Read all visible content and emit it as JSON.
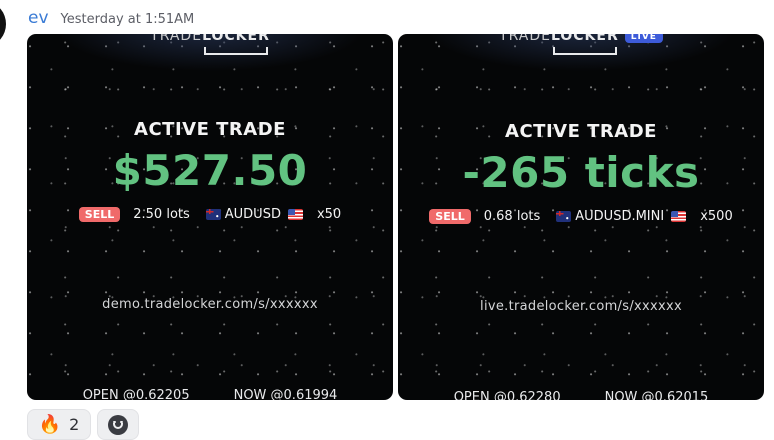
{
  "message": {
    "username": "ev",
    "timestamp": "Yesterday at 1:51AM"
  },
  "cards": [
    {
      "logo_thin": "TRADE",
      "logo_bold": "LOCKER",
      "title": "ACTIVE TRADE",
      "value": "$527.50",
      "side": "SELL",
      "lots": "2.50 lots",
      "symbol": "AUDUSD",
      "multiplier": "x50",
      "url": "demo.tradelocker.com/s/xxxxxx",
      "open": "OPEN @0.62205",
      "now": "NOW @0.61994"
    },
    {
      "logo_thin": "TRADE",
      "logo_bold": "LOCKER",
      "badge": "LIVE",
      "title": "ACTIVE TRADE",
      "value": "-265 ticks",
      "side": "SELL",
      "lots": "0.68 lots",
      "symbol": "AUDUSD.MINI",
      "multiplier": "x500",
      "url": "live.tradelocker.com/s/xxxxxx",
      "open": "OPEN @0.62280",
      "now": "NOW @0.62015"
    }
  ],
  "reactions": [
    {
      "icon": "fire-icon",
      "count": "2"
    },
    {
      "icon": "add-reaction-icon"
    }
  ],
  "colors": {
    "profit_green": "#62c281",
    "sell_red": "#f06a6a",
    "live_blue": "#3d5bd9",
    "username_blue": "#3a7bd5"
  }
}
